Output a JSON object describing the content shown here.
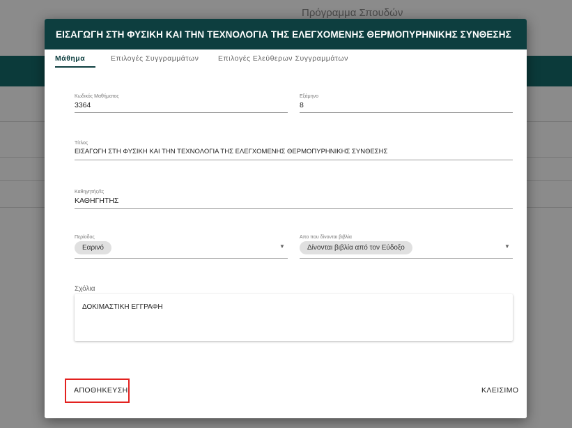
{
  "background": {
    "title": "Πρόγραμμα Σπουδών"
  },
  "dialog": {
    "title": "ΕΙΣΑΓΩΓΗ ΣΤΗ ΦΥΣΙΚΗ ΚΑΙ ΤΗΝ ΤΕΧΝΟΛΟΓΙΑ ΤΗΣ ΕΛΕΓΧΟΜΕΝΗΣ ΘΕΡΜΟΠΥΡΗΝΙΚΗΣ ΣΥΝΘΕΣΗΣ",
    "tabs": [
      {
        "label": "Μάθημα",
        "active": true
      },
      {
        "label": "Επιλογές Συγγραμμάτων",
        "active": false
      },
      {
        "label": "Επιλογές Ελεύθερων Συγγραμμάτων",
        "active": false
      }
    ],
    "fields": {
      "course_code": {
        "label": "Κωδικός Μαθήματος",
        "value": "3364"
      },
      "semester": {
        "label": "Εξάμηνο",
        "value": "8"
      },
      "title": {
        "label": "Τίτλος",
        "value": "ΕΙΣΑΓΩΓΗ ΣΤΗ ΦΥΣΙΚΗ ΚΑΙ ΤΗΝ ΤΕΧΝΟΛΟΓΙΑ ΤΗΣ ΕΛΕΓΧΟΜΕΝΗΣ ΘΕΡΜΟΠΥΡΗΝΙΚΗΣ ΣΥΝΘΕΣΗΣ"
      },
      "professors": {
        "label": "Καθηγητής/ές",
        "value": "ΚΑΘΗΓΗΤΗΣ"
      },
      "period": {
        "label": "Περίοδος",
        "value": "Εαρινό"
      },
      "books_source": {
        "label": "Απο που δίνονται βιβλία",
        "value": "Δίνονται βιβλία από τον Εύδοξο"
      }
    },
    "comments": {
      "label": "Σχόλια",
      "value": "ΔΟΚΙΜΑΣΤΙΚΗ ΕΓΓΡΑΦΗ"
    },
    "actions": {
      "save_label": "ΑΠΟΘΗΚΕΥΣΗ",
      "close_label": "ΚΛΕΙΣΙΜΟ"
    }
  },
  "colors": {
    "header": "#0d3e3f",
    "highlight": "#e3211f"
  },
  "icons": {
    "dropdown": "chevron-down-icon"
  }
}
